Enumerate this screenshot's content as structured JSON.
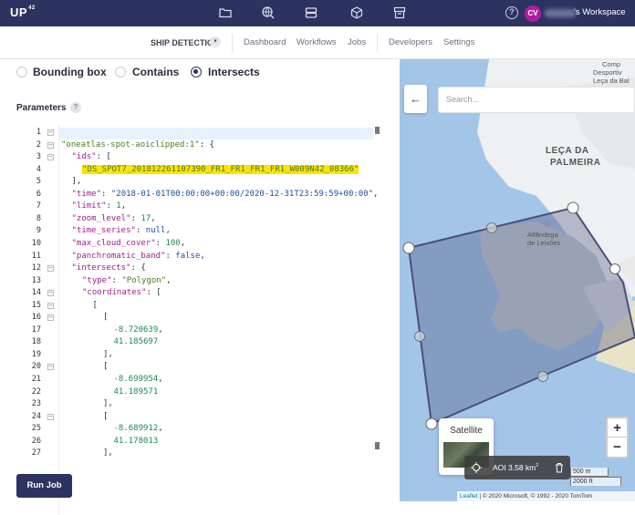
{
  "topbar": {
    "logo": "UP",
    "logo_sup": "42",
    "icons": [
      "folder-icon",
      "globe-search-icon",
      "storage-icon",
      "cube-icon",
      "archive-icon"
    ],
    "help": "?",
    "avatar_initials": "CV",
    "workspace_suffix": "'s Workspace"
  },
  "subbar": {
    "project_name": "SHIP DETECTIO",
    "nav1": [
      "Dashboard",
      "Workflows",
      "Jobs"
    ],
    "nav2": [
      "Developers",
      "Settings"
    ]
  },
  "filter": {
    "options": [
      "Bounding box",
      "Contains",
      "Intersects"
    ],
    "selected": "Intersects"
  },
  "parameters": {
    "label": "Parameters",
    "help": "?"
  },
  "editor": {
    "lines": [
      {
        "n": "1",
        "fold": "−",
        "indent": 0,
        "html": ""
      },
      {
        "n": "2",
        "fold": "−",
        "indent": 0,
        "html": "<span class='str'>\"oneatlas-spot-aoiclipped:1\"</span><span class='pun'>: {</span>"
      },
      {
        "n": "3",
        "fold": "−",
        "indent": 1,
        "html": "<span class='key'>\"ids\"</span><span class='pun'>: [</span>"
      },
      {
        "n": "4",
        "fold": "",
        "indent": 2,
        "html": "<span class='str hl'>\"DS_SPOT7_201812261107390_FR1_FR1_FR1_FR1_W009N42_08366\"</span>"
      },
      {
        "n": "5",
        "fold": "",
        "indent": 1,
        "html": "<span class='pun'>],</span>"
      },
      {
        "n": "6",
        "fold": "",
        "indent": 1,
        "html": "<span class='key'>\"time\"</span><span class='pun'>: </span><span class='kw'>\"2018-01-01T00:00:00+00:00/2020-12-31T23:59:59+00:00\"</span><span class='pun'>,</span>"
      },
      {
        "n": "7",
        "fold": "",
        "indent": 1,
        "html": "<span class='key'>\"limit\"</span><span class='pun'>: </span><span class='num'>1</span><span class='pun'>,</span>"
      },
      {
        "n": "8",
        "fold": "",
        "indent": 1,
        "html": "<span class='key'>\"zoom_level\"</span><span class='pun'>: </span><span class='num'>17</span><span class='pun'>,</span>"
      },
      {
        "n": "9",
        "fold": "",
        "indent": 1,
        "html": "<span class='key'>\"time_series\"</span><span class='pun'>: </span><span class='kw'>null</span><span class='pun'>,</span>"
      },
      {
        "n": "10",
        "fold": "",
        "indent": 1,
        "html": "<span class='key'>\"max_cloud_cover\"</span><span class='pun'>: </span><span class='num'>100</span><span class='pun'>,</span>"
      },
      {
        "n": "11",
        "fold": "",
        "indent": 1,
        "html": "<span class='key'>\"panchromatic_band\"</span><span class='pun'>: </span><span class='kw'>false</span><span class='pun'>,</span>"
      },
      {
        "n": "12",
        "fold": "−",
        "indent": 1,
        "html": "<span class='key'>\"intersects\"</span><span class='pun'>: {</span>"
      },
      {
        "n": "13",
        "fold": "",
        "indent": 2,
        "html": "<span class='key'>\"type\"</span><span class='pun'>: </span><span class='str'>\"Polygon\"</span><span class='pun'>,</span>"
      },
      {
        "n": "14",
        "fold": "−",
        "indent": 2,
        "html": "<span class='key'>\"coordinates\"</span><span class='pun'>: [</span>"
      },
      {
        "n": "15",
        "fold": "−",
        "indent": 3,
        "html": "<span class='pun'>[</span>"
      },
      {
        "n": "16",
        "fold": "−",
        "indent": 4,
        "html": "<span class='pun'>[</span>"
      },
      {
        "n": "17",
        "fold": "",
        "indent": 5,
        "html": "<span class='num'>-8.720639</span><span class='pun'>,</span>"
      },
      {
        "n": "18",
        "fold": "",
        "indent": 5,
        "html": "<span class='num'>41.185697</span>"
      },
      {
        "n": "19",
        "fold": "",
        "indent": 4,
        "html": "<span class='pun'>],</span>"
      },
      {
        "n": "20",
        "fold": "−",
        "indent": 4,
        "html": "<span class='pun'>[</span>"
      },
      {
        "n": "21",
        "fold": "",
        "indent": 5,
        "html": "<span class='num'>-8.699954</span><span class='pun'>,</span>"
      },
      {
        "n": "22",
        "fold": "",
        "indent": 5,
        "html": "<span class='num'>41.189571</span>"
      },
      {
        "n": "23",
        "fold": "",
        "indent": 4,
        "html": "<span class='pun'>],</span>"
      },
      {
        "n": "24",
        "fold": "−",
        "indent": 4,
        "html": "<span class='pun'>[</span>"
      },
      {
        "n": "25",
        "fold": "",
        "indent": 5,
        "html": "<span class='num'>-8.689912</span><span class='pun'>,</span>"
      },
      {
        "n": "26",
        "fold": "",
        "indent": 5,
        "html": "<span class='num'>41.178013</span>"
      },
      {
        "n": "27",
        "fold": "",
        "indent": 4,
        "html": "<span class='pun'>],</span>"
      }
    ]
  },
  "run_button": "Run Job",
  "map": {
    "back": "←",
    "search_placeholder": "Search...",
    "place_label_1": "LEÇA DA",
    "place_label_2": "PALMEIRA",
    "poi_label_1": "Alfândega",
    "poi_label_2": "de Leixões",
    "corner_label_1": "Comp",
    "corner_label_2": "Desportiv",
    "corner_label_3": "Leça da Bal",
    "zoom_in": "+",
    "zoom_out": "−",
    "layer_label": "Satellite",
    "aoi_text": "AOI 3.58 km",
    "aoi_sup": "2",
    "scale_m": "500 m",
    "scale_ft": "2000 ft",
    "attribution_link": "Leaflet",
    "attribution_text": " | © 2020 Microsoft, © 1992 - 2020 TomTom",
    "colors": {
      "water": "#a3c5e8",
      "land": "#eef0f2",
      "polygon_fill": "#6f8fbf",
      "polygon_stroke": "#4a5079",
      "brand": "#2d3361"
    }
  }
}
